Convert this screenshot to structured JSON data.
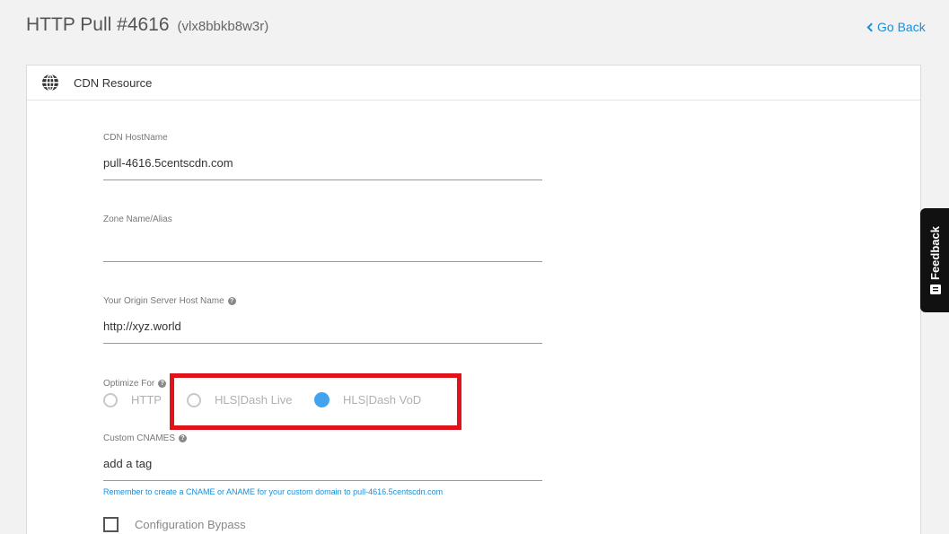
{
  "header": {
    "title": "HTTP Pull #4616",
    "subtitle": "(vlx8bbkb8w3r)",
    "go_back": "Go Back"
  },
  "card": {
    "title": "CDN Resource",
    "icon": "globe-icon"
  },
  "fields": {
    "hostname": {
      "label": "CDN HostName",
      "value": "pull-4616.5centscdn.com"
    },
    "zone": {
      "label": "Zone Name/Alias",
      "value": ""
    },
    "origin": {
      "label": "Your Origin Server Host Name",
      "value": "http://xyz.world"
    },
    "cnames": {
      "label": "Custom CNAMES",
      "value": "add a tag"
    }
  },
  "optimize": {
    "label": "Optimize For",
    "options": [
      {
        "label": "HTTP",
        "selected": false
      },
      {
        "label": "HLS|Dash Live",
        "selected": false
      },
      {
        "label": "HLS|Dash VoD",
        "selected": true
      }
    ]
  },
  "hint": "Remember to create a CNAME or ANAME for your custom domain to pull-4616.5centscdn.com",
  "bypass": {
    "label": "Configuration Bypass",
    "checked": false
  },
  "feedback": {
    "label": "Feedback"
  },
  "colors": {
    "accent": "#1a8fd8",
    "radio_selected": "#44a3ee",
    "highlight": "#e0121b"
  }
}
